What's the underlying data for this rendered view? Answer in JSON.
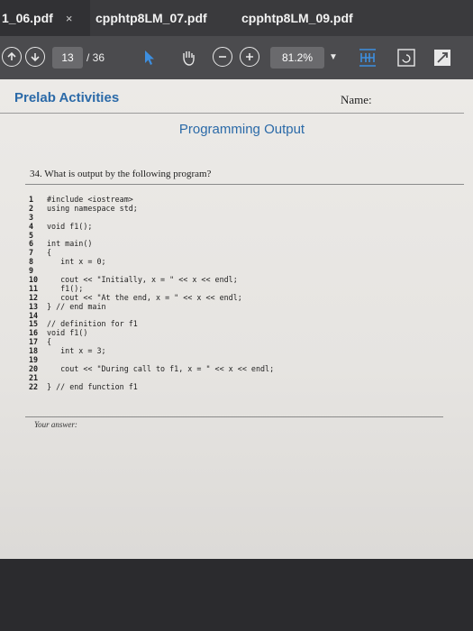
{
  "tabs": [
    {
      "label": "1_06.pdf",
      "close": "×"
    },
    {
      "label": "cpphtp8LM_07.pdf"
    },
    {
      "label": "cpphtp8LM_09.pdf"
    }
  ],
  "toolbar": {
    "current_page": "13",
    "total_pages": "/ 36",
    "zoom": "81.2%"
  },
  "document": {
    "section_title": "Prelab Activities",
    "name_label": "Name:",
    "heading": "Programming Output",
    "question": "34. What is output by the following program?",
    "code_lines": [
      {
        "n": "1",
        "t": "#include <iostream>"
      },
      {
        "n": "2",
        "t": "using namespace std;"
      },
      {
        "n": "3",
        "t": ""
      },
      {
        "n": "4",
        "t": "void f1();"
      },
      {
        "n": "5",
        "t": ""
      },
      {
        "n": "6",
        "t": "int main()"
      },
      {
        "n": "7",
        "t": "{"
      },
      {
        "n": "8",
        "t": "   int x = 0;"
      },
      {
        "n": "9",
        "t": ""
      },
      {
        "n": "10",
        "t": "   cout << \"Initially, x = \" << x << endl;"
      },
      {
        "n": "11",
        "t": "   f1();"
      },
      {
        "n": "12",
        "t": "   cout << \"At the end, x = \" << x << endl;"
      },
      {
        "n": "13",
        "t": "} // end main"
      },
      {
        "n": "14",
        "t": ""
      },
      {
        "n": "15",
        "t": "// definition for f1"
      },
      {
        "n": "16",
        "t": "void f1()"
      },
      {
        "n": "17",
        "t": "{"
      },
      {
        "n": "18",
        "t": "   int x = 3;"
      },
      {
        "n": "19",
        "t": ""
      },
      {
        "n": "20",
        "t": "   cout << \"During call to f1, x = \" << x << endl;"
      },
      {
        "n": "21",
        "t": ""
      },
      {
        "n": "22",
        "t": "} // end function f1"
      }
    ],
    "answer_label": "Your answer:"
  }
}
